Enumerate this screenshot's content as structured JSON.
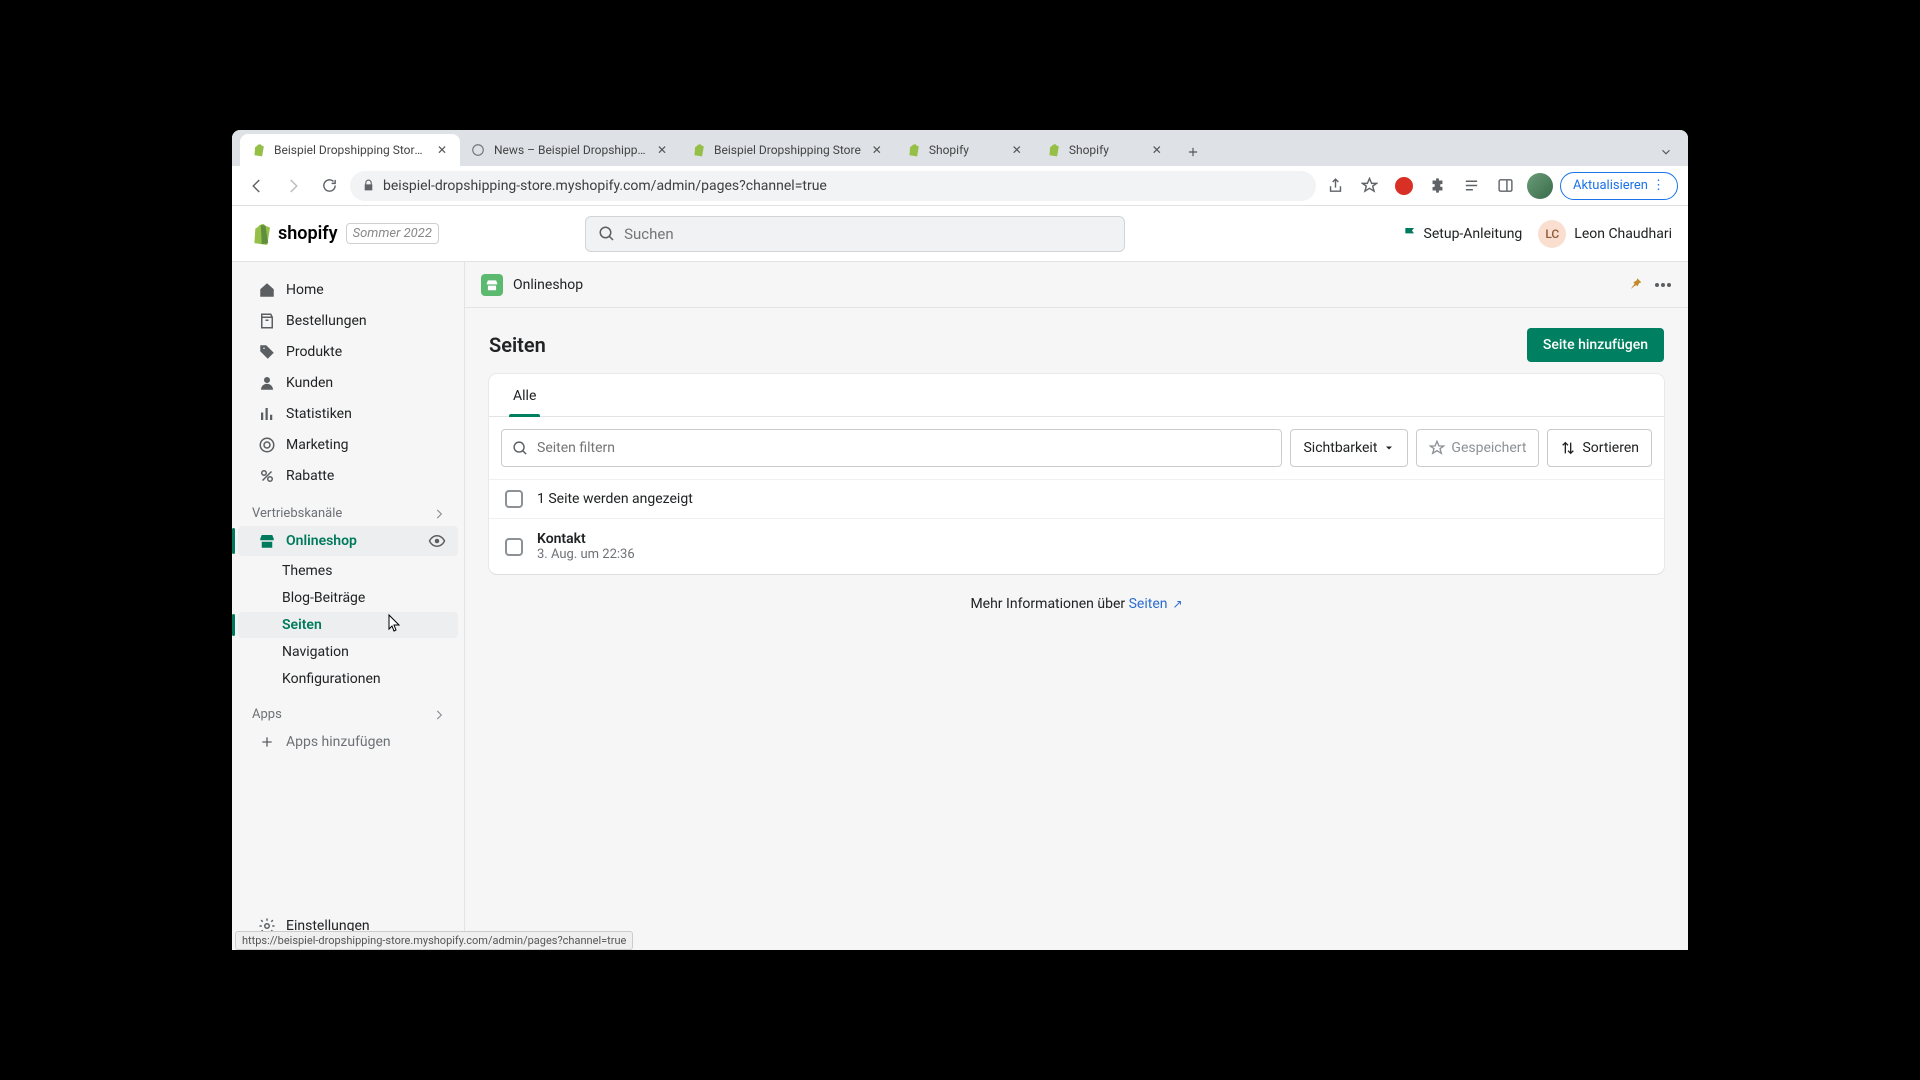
{
  "browser": {
    "tabs": [
      {
        "title": "Beispiel Dropshipping Store · S",
        "favicon": "shopify"
      },
      {
        "title": "News – Beispiel Dropshipping",
        "favicon": "globe"
      },
      {
        "title": "Beispiel Dropshipping Store",
        "favicon": "shopify"
      },
      {
        "title": "Shopify",
        "favicon": "shopify"
      },
      {
        "title": "Shopify",
        "favicon": "shopify"
      }
    ],
    "url": "beispiel-dropshipping-store.myshopify.com/admin/pages?channel=true",
    "update_label": "Aktualisieren",
    "status_url": "https://beispiel-dropshipping-store.myshopify.com/admin/pages?channel=true"
  },
  "header": {
    "brand": "shopify",
    "season_badge": "Sommer 2022",
    "search_placeholder": "Suchen",
    "setup_label": "Setup-Anleitung",
    "user_initials": "LC",
    "user_name": "Leon Chaudhari"
  },
  "sidebar": {
    "items": [
      {
        "label": "Home",
        "icon": "home"
      },
      {
        "label": "Bestellungen",
        "icon": "orders"
      },
      {
        "label": "Produkte",
        "icon": "tag"
      },
      {
        "label": "Kunden",
        "icon": "person"
      },
      {
        "label": "Statistiken",
        "icon": "analytics"
      },
      {
        "label": "Marketing",
        "icon": "target"
      },
      {
        "label": "Rabatte",
        "icon": "discount"
      }
    ],
    "channels_header": "Vertriebskanäle",
    "onlineshop": {
      "label": "Onlineshop"
    },
    "sub": [
      {
        "label": "Themes"
      },
      {
        "label": "Blog-Beiträge"
      },
      {
        "label": "Seiten",
        "active": true
      },
      {
        "label": "Navigation"
      },
      {
        "label": "Konfigurationen"
      }
    ],
    "apps_header": "Apps",
    "add_apps": "Apps hinzufügen",
    "settings": "Einstellungen"
  },
  "channel": {
    "title": "Onlineshop"
  },
  "page": {
    "title": "Seiten",
    "add_button": "Seite hinzufügen",
    "tab_all": "Alle",
    "filter_placeholder": "Seiten filtern",
    "visibility_btn": "Sichtbarkeit",
    "saved_btn": "Gespeichert",
    "sort_btn": "Sortieren",
    "count_text": "1 Seite werden angezeigt",
    "rows": [
      {
        "title": "Kontakt",
        "meta": "3. Aug. um 22:36"
      }
    ],
    "more_prefix": "Mehr Informationen über ",
    "more_link": "Seiten"
  }
}
